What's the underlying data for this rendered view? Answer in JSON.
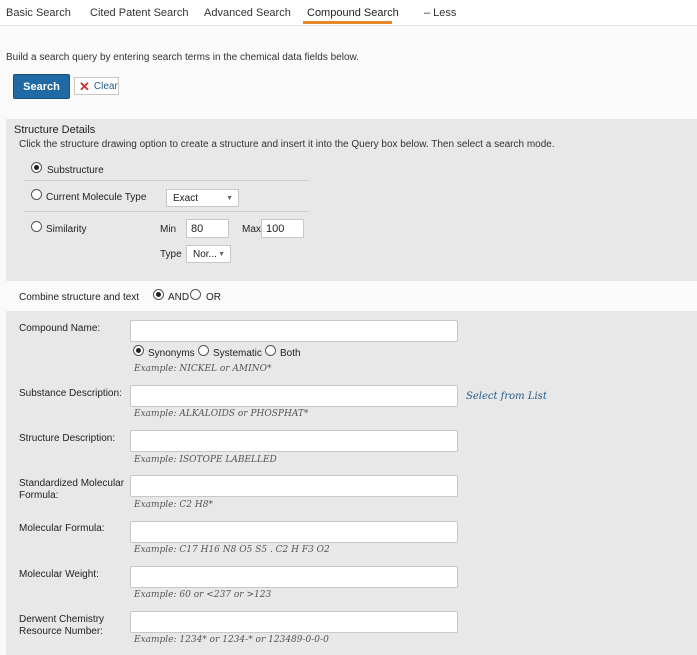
{
  "tabs": {
    "basic": "Basic Search",
    "cited": "Cited Patent Search",
    "advanced": "Advanced Search",
    "compound": "Compound Search",
    "less": "–  Less"
  },
  "intro": "Build a search query by entering search terms in the chemical data fields below.",
  "buttons": {
    "search": "Search",
    "clear": "Clear"
  },
  "structure": {
    "title": "Structure Details",
    "description": "Click the structure drawing option to create a structure and insert it into the Query box below. Then select a search mode.",
    "substructure": "Substructure",
    "current_molecule": "Current Molecule Type",
    "current_molecule_value": "Exact",
    "similarity": "Similarity",
    "min_label": "Min",
    "min_value": "80",
    "max_label": "Max",
    "max_value": "100",
    "type_label": "Type",
    "type_value": "Nor..."
  },
  "combine": {
    "label": "Combine structure and text",
    "and": "AND",
    "or": "OR"
  },
  "fields": {
    "compound_name": {
      "label": "Compound Name:",
      "example": "Example: NICKEL or AMINO*"
    },
    "name_options": {
      "synonyms": "Synonyms",
      "systematic": "Systematic",
      "both": "Both"
    },
    "substance_description": {
      "label": "Substance Description:",
      "example": "Example: ALKALOIDS or PHOSPHAT*",
      "link": "Select from List"
    },
    "structure_description": {
      "label": "Structure Description:",
      "example": "Example: ISOTOPE LABELLED"
    },
    "standardized_formula": {
      "label": "Standardized Molecular Formula:",
      "example": "Example: C2 H8*"
    },
    "molecular_formula": {
      "label": "Molecular Formula:",
      "example": "Example: C17 H16 N8 O5 S5 . C2 H F3 O2"
    },
    "molecular_weight": {
      "label": "Molecular Weight:",
      "example": "Example: 60 or <237 or >123"
    },
    "derwent": {
      "label": "Derwent Chemistry Resource Number:",
      "example": "Example: 1234* or 1234-* or 123489-0-0-0"
    }
  }
}
